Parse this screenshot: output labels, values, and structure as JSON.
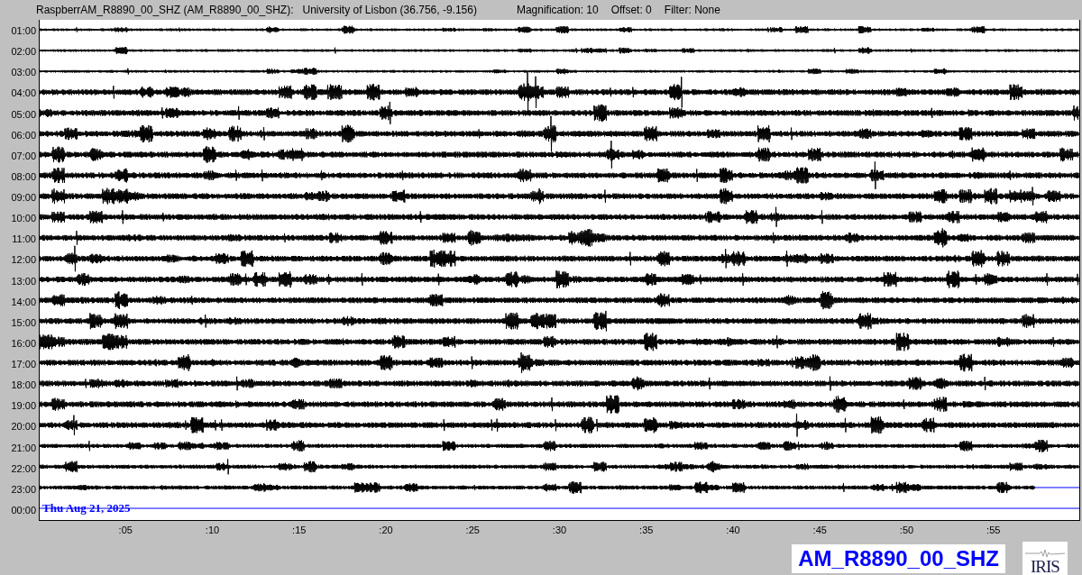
{
  "header": {
    "station": "RaspberrAM_R8890_00_SHZ (AM_R8890_00_SHZ):",
    "location": "University of Lisbon (36.756, -9.156)",
    "magnification": "Magnification: 10",
    "offset": "Offset: 0",
    "filter": "Filter: None"
  },
  "rows": [
    {
      "label": "01:00",
      "kind": "full"
    },
    {
      "label": "02:00",
      "kind": "full"
    },
    {
      "label": "03:00",
      "kind": "full"
    },
    {
      "label": "04:00",
      "kind": "full"
    },
    {
      "label": "05:00",
      "kind": "full"
    },
    {
      "label": "06:00",
      "kind": "full"
    },
    {
      "label": "07:00",
      "kind": "full"
    },
    {
      "label": "08:00",
      "kind": "full"
    },
    {
      "label": "09:00",
      "kind": "full"
    },
    {
      "label": "10:00",
      "kind": "full"
    },
    {
      "label": "11:00",
      "kind": "full"
    },
    {
      "label": "12:00",
      "kind": "full"
    },
    {
      "label": "13:00",
      "kind": "full"
    },
    {
      "label": "14:00",
      "kind": "full"
    },
    {
      "label": "15:00",
      "kind": "full"
    },
    {
      "label": "16:00",
      "kind": "full"
    },
    {
      "label": "17:00",
      "kind": "full"
    },
    {
      "label": "18:00",
      "kind": "full"
    },
    {
      "label": "19:00",
      "kind": "full"
    },
    {
      "label": "20:00",
      "kind": "full"
    },
    {
      "label": "21:00",
      "kind": "full"
    },
    {
      "label": "22:00",
      "kind": "full"
    },
    {
      "label": "23:00",
      "kind": "partial"
    },
    {
      "label": "00:00",
      "kind": "empty"
    }
  ],
  "date_label": "Thu Aug 21, 2025",
  "x_ticks": [
    ":05",
    ":10",
    ":15",
    ":20",
    ":25",
    ":30",
    ":35",
    ":40",
    ":45",
    ":50",
    ":55"
  ],
  "station_badge": "AM_R8890_00_SHZ",
  "logo": "IRIS"
}
